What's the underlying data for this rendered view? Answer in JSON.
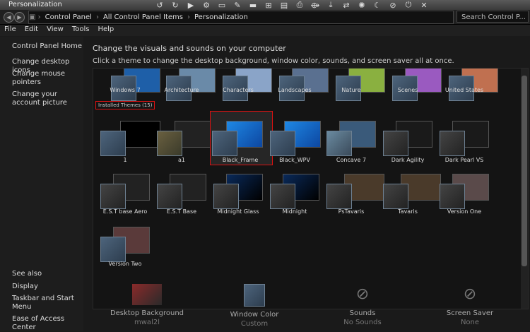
{
  "window": {
    "title": "Personalization"
  },
  "address": {
    "crumbs": [
      "Control Panel",
      "All Control Panel Items",
      "Personalization"
    ],
    "search_placeholder": "Search Control P..."
  },
  "menu": [
    "File",
    "Edit",
    "View",
    "Tools",
    "Help"
  ],
  "sidebar": {
    "items": [
      "Control Panel Home",
      "Change desktop icons",
      "Change mouse pointers",
      "Change your account picture"
    ],
    "see_also_title": "See also",
    "see_also": [
      "Display",
      "Taskbar and Start Menu",
      "Ease of Access Center"
    ]
  },
  "main": {
    "headline": "Change the visuals and sounds on your computer",
    "subline": "Click a theme to change the desktop background, window color, sounds, and screen saver all at once.",
    "aero_themes": [
      "Windows 7",
      "Architecture",
      "Characters",
      "Landscapes",
      "Nature",
      "Scenes",
      "United States"
    ],
    "installed_group_title": "Installed Themes (15)",
    "installed_themes": [
      "1",
      "a1",
      "Black_Frame",
      "Black_WPV",
      "Concave 7",
      "Dark Agility",
      "Dark Pearl VS",
      "E.S.T  base Aero",
      "E.S.T Base",
      "Midnight Glass",
      "Midnight",
      "PsTavaris",
      "Tavaris",
      "Version One",
      "Version Two"
    ],
    "selected_theme": "Black_Frame"
  },
  "bottom": {
    "desktop_background": {
      "label": "Desktop Background",
      "value": "mwal2l"
    },
    "window_color": {
      "label": "Window Color",
      "value": "Custom"
    },
    "sounds": {
      "label": "Sounds",
      "value": "No Sounds"
    },
    "screen_saver": {
      "label": "Screen Saver",
      "value": "None"
    }
  },
  "colors": {
    "selection_border": "#dd1111",
    "accent": "#4d647c"
  }
}
